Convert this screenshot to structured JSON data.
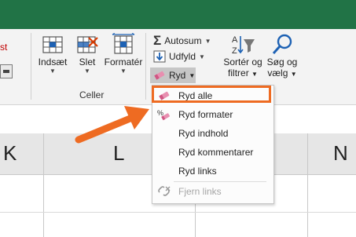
{
  "ribbon": {
    "cutoff_text": "st",
    "cells_group": {
      "label": "Celler",
      "insert_label": "Indsæt",
      "delete_label": "Slet",
      "format_label": "Formatér"
    },
    "editing_group": {
      "autosum_label": "Autosum",
      "fill_label": "Udfyld",
      "clear_label": "Ryd",
      "sort_label_1": "Sortér og",
      "sort_label_2": "filtrer",
      "find_label_1": "Søg og",
      "find_label_2": "vælg"
    }
  },
  "columns": [
    "K",
    "L",
    "N"
  ],
  "clear_menu": {
    "items": [
      {
        "label": "Ryd alle",
        "icon": "eraser-icon"
      },
      {
        "label": "Ryd formater",
        "icon": "clear-formats-icon"
      },
      {
        "label": "Ryd indhold",
        "icon": ""
      },
      {
        "label": "Ryd kommentarer",
        "icon": ""
      },
      {
        "label": "Ryd links",
        "icon": ""
      },
      {
        "label": "Fjern links",
        "icon": "remove-links-icon",
        "disabled": true
      }
    ]
  },
  "colors": {
    "titlebar": "#217346",
    "highlight": "#ee6b22",
    "accent_blue": "#1e62b4"
  }
}
